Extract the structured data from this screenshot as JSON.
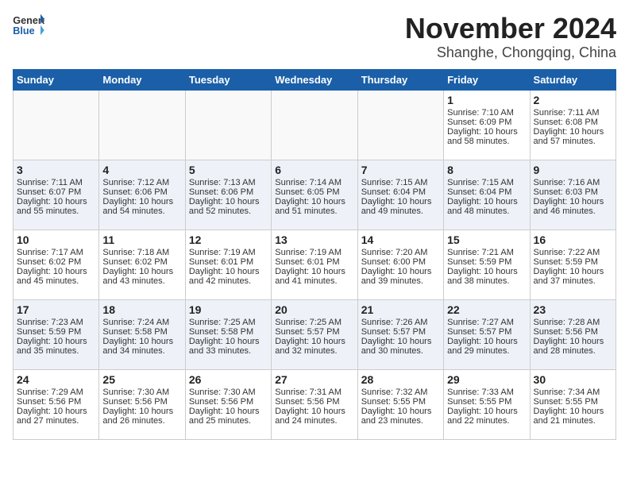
{
  "header": {
    "logo_general": "General",
    "logo_blue": "Blue",
    "month_title": "November 2024",
    "location": "Shanghe, Chongqing, China"
  },
  "days_of_week": [
    "Sunday",
    "Monday",
    "Tuesday",
    "Wednesday",
    "Thursday",
    "Friday",
    "Saturday"
  ],
  "weeks": [
    [
      {
        "day": "",
        "content": ""
      },
      {
        "day": "",
        "content": ""
      },
      {
        "day": "",
        "content": ""
      },
      {
        "day": "",
        "content": ""
      },
      {
        "day": "",
        "content": ""
      },
      {
        "day": "1",
        "content": "Sunrise: 7:10 AM\nSunset: 6:09 PM\nDaylight: 10 hours and 58 minutes."
      },
      {
        "day": "2",
        "content": "Sunrise: 7:11 AM\nSunset: 6:08 PM\nDaylight: 10 hours and 57 minutes."
      }
    ],
    [
      {
        "day": "3",
        "content": "Sunrise: 7:11 AM\nSunset: 6:07 PM\nDaylight: 10 hours and 55 minutes."
      },
      {
        "day": "4",
        "content": "Sunrise: 7:12 AM\nSunset: 6:06 PM\nDaylight: 10 hours and 54 minutes."
      },
      {
        "day": "5",
        "content": "Sunrise: 7:13 AM\nSunset: 6:06 PM\nDaylight: 10 hours and 52 minutes."
      },
      {
        "day": "6",
        "content": "Sunrise: 7:14 AM\nSunset: 6:05 PM\nDaylight: 10 hours and 51 minutes."
      },
      {
        "day": "7",
        "content": "Sunrise: 7:15 AM\nSunset: 6:04 PM\nDaylight: 10 hours and 49 minutes."
      },
      {
        "day": "8",
        "content": "Sunrise: 7:15 AM\nSunset: 6:04 PM\nDaylight: 10 hours and 48 minutes."
      },
      {
        "day": "9",
        "content": "Sunrise: 7:16 AM\nSunset: 6:03 PM\nDaylight: 10 hours and 46 minutes."
      }
    ],
    [
      {
        "day": "10",
        "content": "Sunrise: 7:17 AM\nSunset: 6:02 PM\nDaylight: 10 hours and 45 minutes."
      },
      {
        "day": "11",
        "content": "Sunrise: 7:18 AM\nSunset: 6:02 PM\nDaylight: 10 hours and 43 minutes."
      },
      {
        "day": "12",
        "content": "Sunrise: 7:19 AM\nSunset: 6:01 PM\nDaylight: 10 hours and 42 minutes."
      },
      {
        "day": "13",
        "content": "Sunrise: 7:19 AM\nSunset: 6:01 PM\nDaylight: 10 hours and 41 minutes."
      },
      {
        "day": "14",
        "content": "Sunrise: 7:20 AM\nSunset: 6:00 PM\nDaylight: 10 hours and 39 minutes."
      },
      {
        "day": "15",
        "content": "Sunrise: 7:21 AM\nSunset: 5:59 PM\nDaylight: 10 hours and 38 minutes."
      },
      {
        "day": "16",
        "content": "Sunrise: 7:22 AM\nSunset: 5:59 PM\nDaylight: 10 hours and 37 minutes."
      }
    ],
    [
      {
        "day": "17",
        "content": "Sunrise: 7:23 AM\nSunset: 5:59 PM\nDaylight: 10 hours and 35 minutes."
      },
      {
        "day": "18",
        "content": "Sunrise: 7:24 AM\nSunset: 5:58 PM\nDaylight: 10 hours and 34 minutes."
      },
      {
        "day": "19",
        "content": "Sunrise: 7:25 AM\nSunset: 5:58 PM\nDaylight: 10 hours and 33 minutes."
      },
      {
        "day": "20",
        "content": "Sunrise: 7:25 AM\nSunset: 5:57 PM\nDaylight: 10 hours and 32 minutes."
      },
      {
        "day": "21",
        "content": "Sunrise: 7:26 AM\nSunset: 5:57 PM\nDaylight: 10 hours and 30 minutes."
      },
      {
        "day": "22",
        "content": "Sunrise: 7:27 AM\nSunset: 5:57 PM\nDaylight: 10 hours and 29 minutes."
      },
      {
        "day": "23",
        "content": "Sunrise: 7:28 AM\nSunset: 5:56 PM\nDaylight: 10 hours and 28 minutes."
      }
    ],
    [
      {
        "day": "24",
        "content": "Sunrise: 7:29 AM\nSunset: 5:56 PM\nDaylight: 10 hours and 27 minutes."
      },
      {
        "day": "25",
        "content": "Sunrise: 7:30 AM\nSunset: 5:56 PM\nDaylight: 10 hours and 26 minutes."
      },
      {
        "day": "26",
        "content": "Sunrise: 7:30 AM\nSunset: 5:56 PM\nDaylight: 10 hours and 25 minutes."
      },
      {
        "day": "27",
        "content": "Sunrise: 7:31 AM\nSunset: 5:56 PM\nDaylight: 10 hours and 24 minutes."
      },
      {
        "day": "28",
        "content": "Sunrise: 7:32 AM\nSunset: 5:55 PM\nDaylight: 10 hours and 23 minutes."
      },
      {
        "day": "29",
        "content": "Sunrise: 7:33 AM\nSunset: 5:55 PM\nDaylight: 10 hours and 22 minutes."
      },
      {
        "day": "30",
        "content": "Sunrise: 7:34 AM\nSunset: 5:55 PM\nDaylight: 10 hours and 21 minutes."
      }
    ]
  ]
}
